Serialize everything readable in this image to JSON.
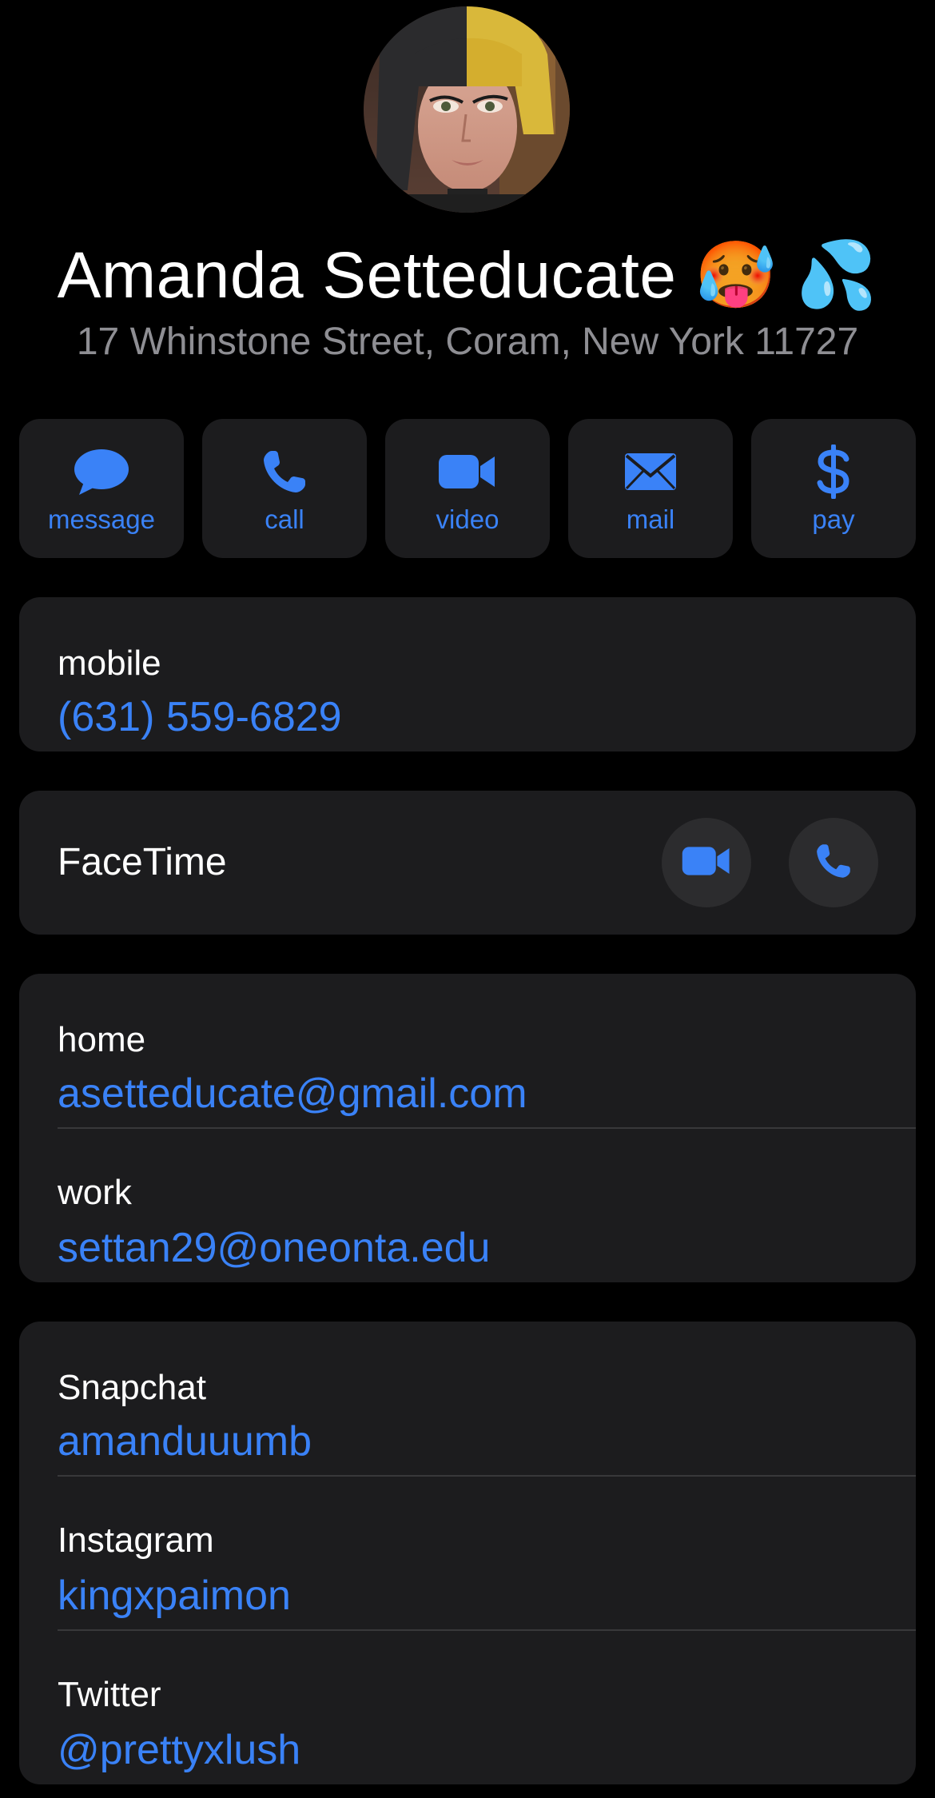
{
  "contact": {
    "name": "Amanda Setteducate 🥵 💦",
    "address": "17 Whinstone Street, Coram, New York 11727"
  },
  "actions": [
    {
      "label": "message",
      "icon": "message-bubble-icon"
    },
    {
      "label": "call",
      "icon": "phone-icon"
    },
    {
      "label": "video",
      "icon": "video-camera-icon"
    },
    {
      "label": "mail",
      "icon": "envelope-icon"
    },
    {
      "label": "pay",
      "icon": "dollar-icon"
    }
  ],
  "phone": {
    "label": "mobile",
    "value": "(631) 559-6829"
  },
  "facetime": {
    "label": "FaceTime",
    "video_icon": "video-camera-icon",
    "audio_icon": "phone-icon"
  },
  "emails": [
    {
      "label": "home",
      "value": "asetteducate@gmail.com"
    },
    {
      "label": "work",
      "value": "settan29@oneonta.edu"
    }
  ],
  "social": [
    {
      "label": "Snapchat",
      "value": "amanduuumb"
    },
    {
      "label": "Instagram",
      "value": "kingxpaimon"
    },
    {
      "label": "Twitter",
      "value": "@prettyxlush"
    }
  ],
  "colors": {
    "background": "#000000",
    "card": "#1c1c1e",
    "accent": "#3a82f7",
    "secondary_text": "#8e8e93",
    "divider": "#38383a"
  }
}
